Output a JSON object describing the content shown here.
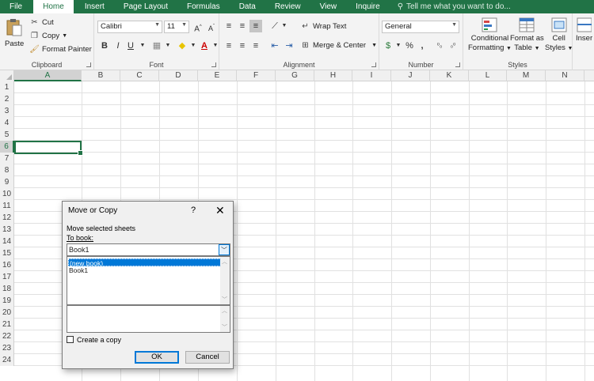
{
  "tabs": [
    "File",
    "Home",
    "Insert",
    "Page Layout",
    "Formulas",
    "Data",
    "Review",
    "View",
    "Inquire"
  ],
  "active_tab": "Home",
  "tell_me": "Tell me what you want to do...",
  "ribbon": {
    "clipboard": {
      "paste": "Paste",
      "cut": "Cut",
      "copy": "Copy",
      "format_painter": "Format Painter",
      "label": "Clipboard"
    },
    "font": {
      "name": "Calibri",
      "size": "11",
      "bold": "B",
      "italic": "I",
      "underline": "U",
      "label": "Font"
    },
    "alignment": {
      "wrap_text": "Wrap Text",
      "merge_center": "Merge & Center",
      "label": "Alignment"
    },
    "number": {
      "format": "General",
      "percent": "%",
      "comma": ",",
      "label": "Number"
    },
    "styles": {
      "conditional": "Conditional",
      "formatting": "Formatting",
      "format_as": "Format as",
      "table": "Table",
      "cell": "Cell",
      "styles_btn": "Styles",
      "label": "Styles"
    },
    "cells": {
      "insert": "Inser"
    }
  },
  "columns": [
    "A",
    "B",
    "C",
    "D",
    "E",
    "F",
    "G",
    "H",
    "I",
    "J",
    "K",
    "L",
    "M",
    "N"
  ],
  "rows": [
    "1",
    "2",
    "3",
    "4",
    "5",
    "6",
    "7",
    "8",
    "9",
    "10",
    "11",
    "12",
    "13",
    "14",
    "15",
    "16",
    "17",
    "18",
    "19",
    "20",
    "21",
    "22",
    "23",
    "24"
  ],
  "selected_cell": "A6",
  "dialog": {
    "title": "Move or Copy",
    "help": "?",
    "close": "✕",
    "move_selected": "Move selected sheets",
    "to_book_label": "To book:",
    "to_book_value": "Book1",
    "list_items": [
      "(new book)",
      "Book1"
    ],
    "selected_item": "(new book)",
    "create_copy": "Create a copy",
    "ok": "OK",
    "cancel": "Cancel"
  },
  "colors": {
    "accent": "#217346",
    "dialog_select": "#0078d7"
  }
}
